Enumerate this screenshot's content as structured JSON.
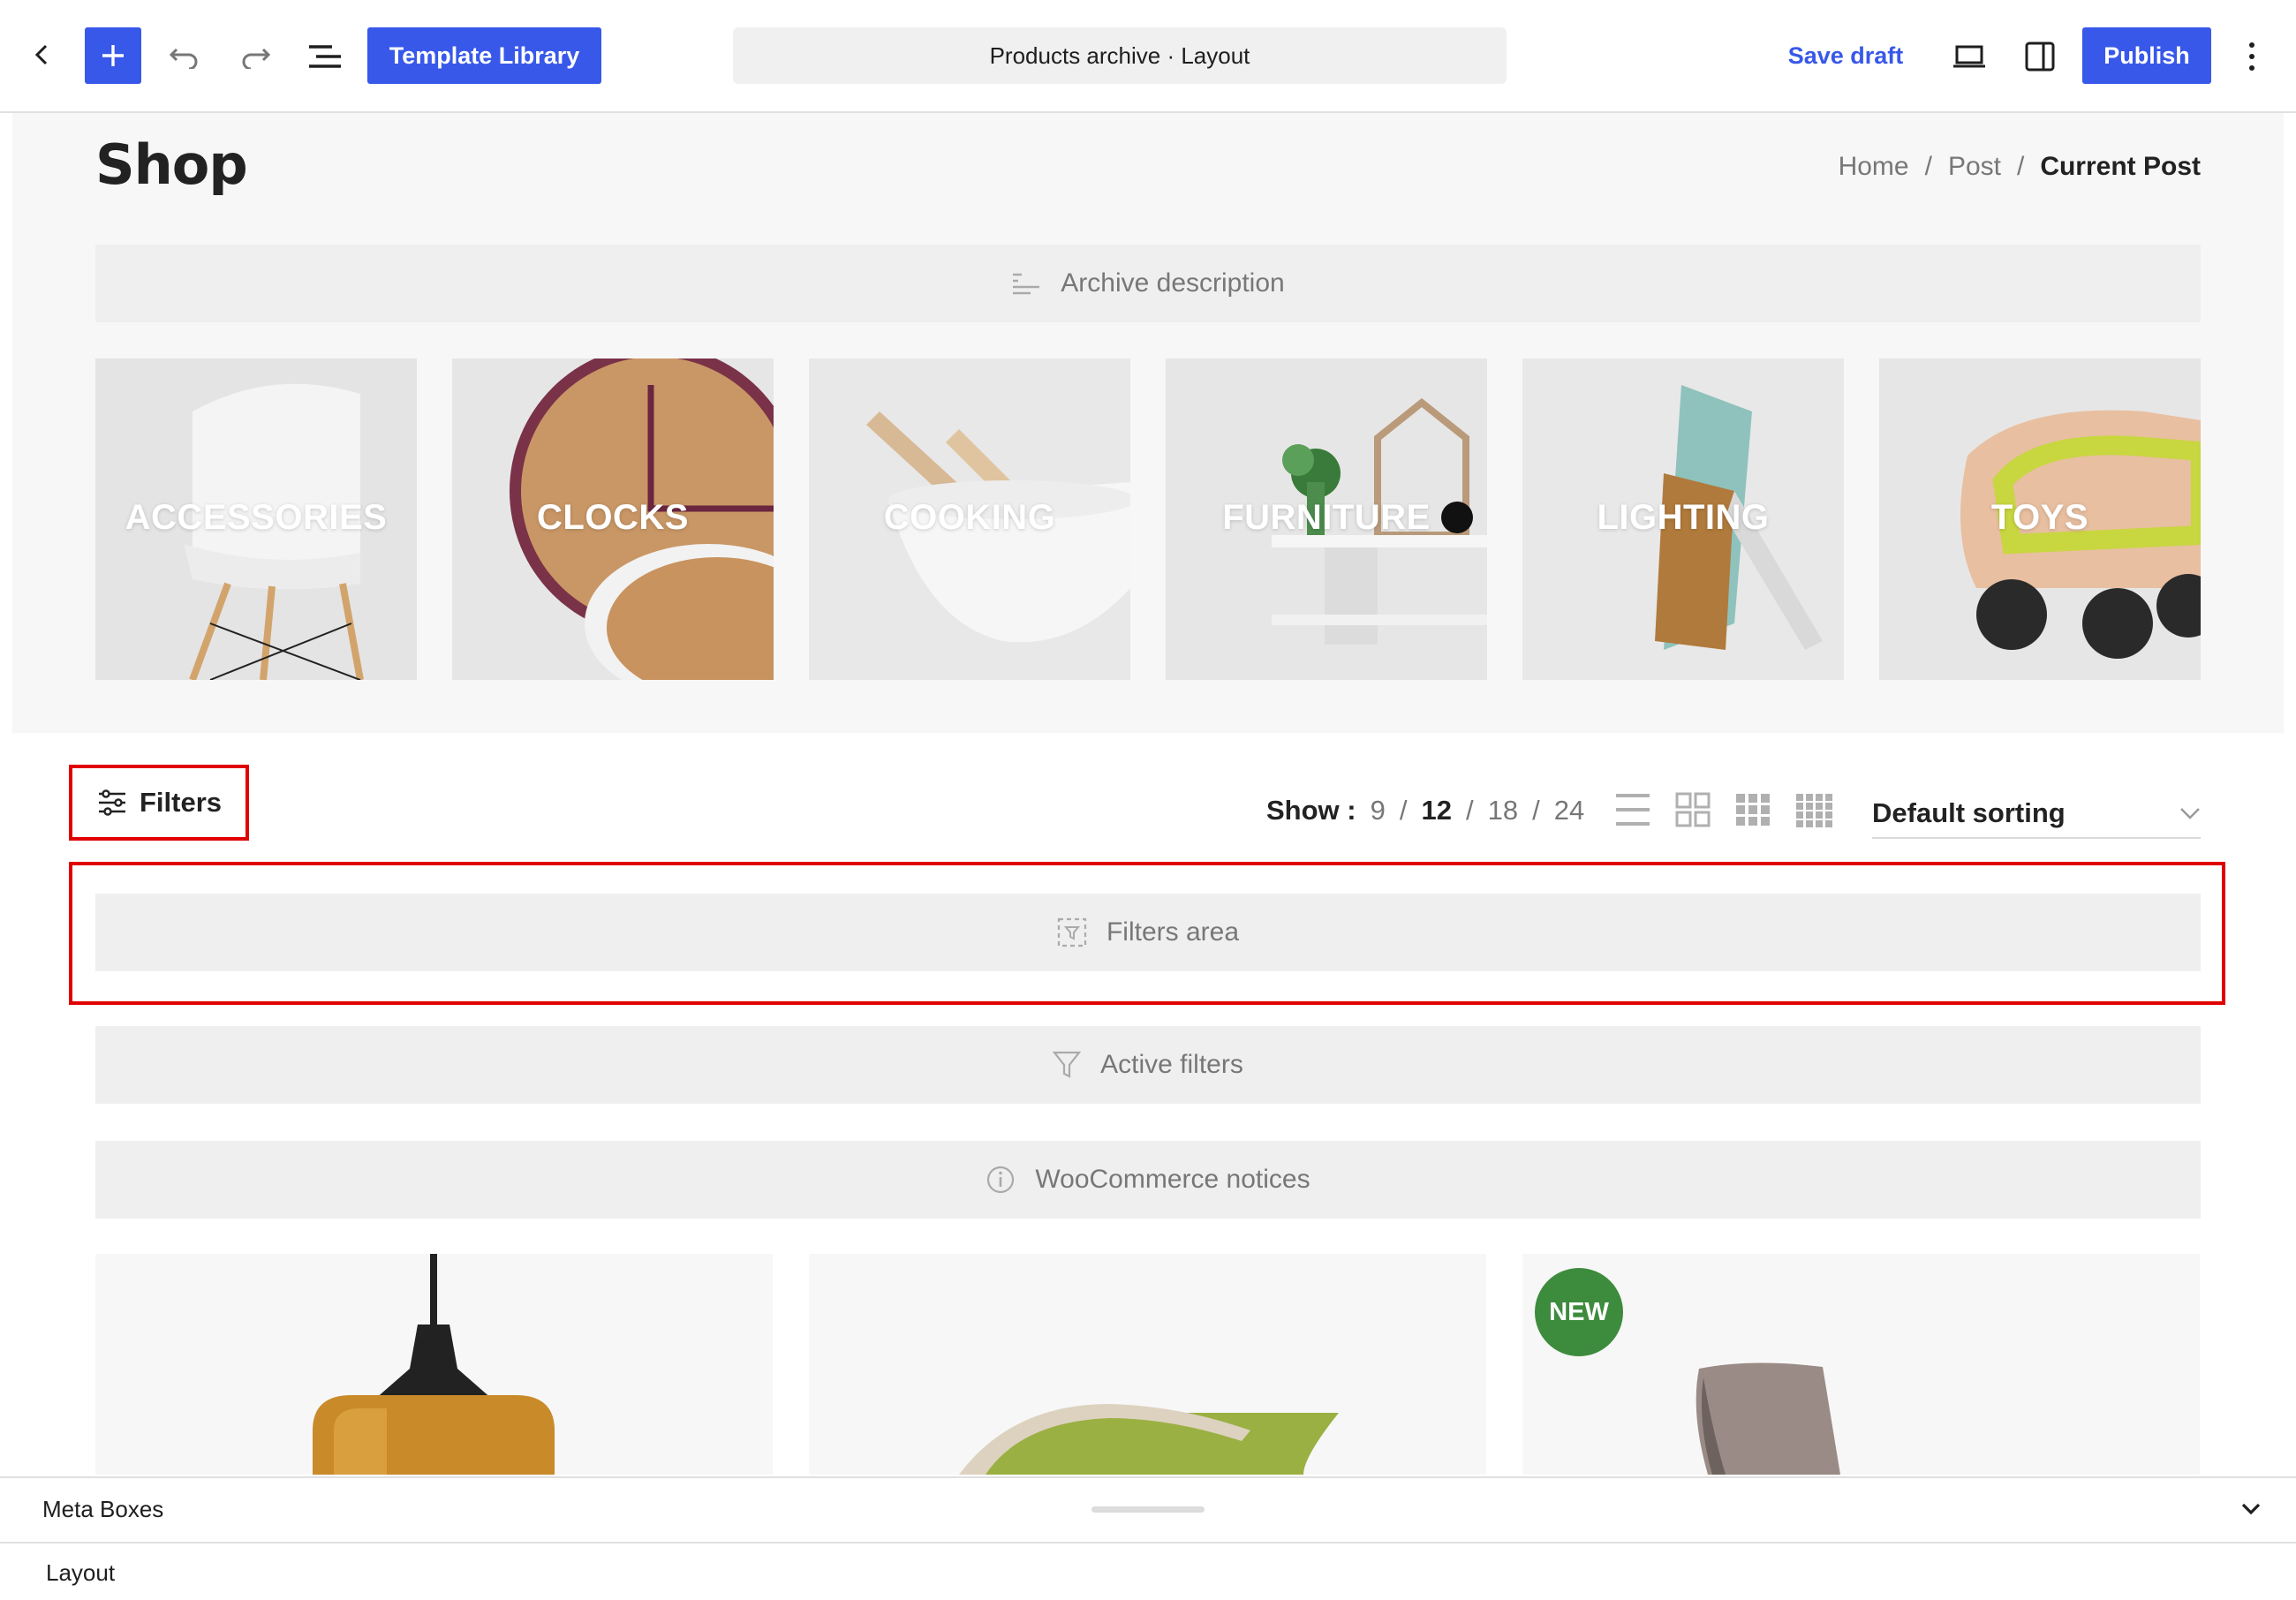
{
  "toolbar": {
    "template_library": "Template Library",
    "document_title": "Products archive · Layout",
    "save_draft": "Save draft",
    "publish": "Publish"
  },
  "page": {
    "title": "Shop",
    "breadcrumb": [
      "Home",
      "/",
      "Post",
      "/",
      "Current Post"
    ]
  },
  "blocks": {
    "archive_description": "Archive description",
    "filters_area": "Filters area",
    "active_filters": "Active filters",
    "woo_notices": "WooCommerce notices"
  },
  "categories": [
    "ACCESSORIES",
    "CLOCKS",
    "COOKING",
    "FURNITURE",
    "LIGHTING",
    "TOYS"
  ],
  "shop_controls": {
    "filters_label": "Filters",
    "show_label": "Show :",
    "per_page": [
      "9",
      "/",
      "12",
      "/",
      "18",
      "/",
      "24"
    ],
    "sorting": "Default sorting"
  },
  "products": {
    "badge": "NEW"
  },
  "meta": {
    "title": "Meta Boxes",
    "layout": "Layout"
  },
  "colors": {
    "accent": "#3858e9",
    "highlight": "#e00000",
    "badge": "#3d8b3d"
  }
}
